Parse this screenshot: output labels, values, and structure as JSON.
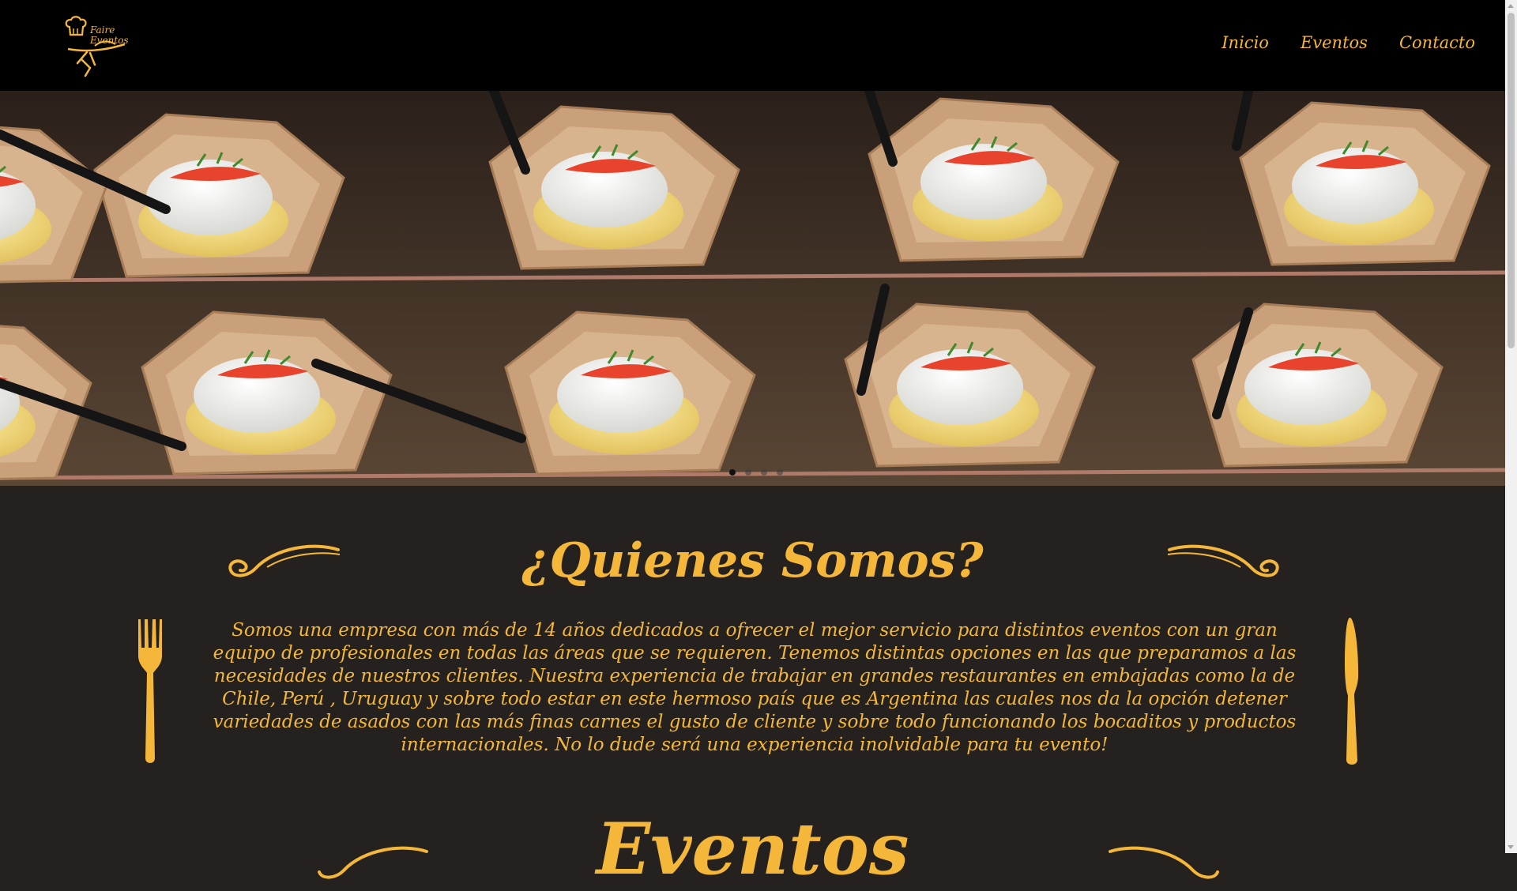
{
  "brand": {
    "logo_line1": "Faire",
    "logo_line2": "Eventos",
    "color": "#f4b73a"
  },
  "nav": {
    "items": [
      {
        "label": "Inicio"
      },
      {
        "label": "Eventos"
      },
      {
        "label": "Contacto"
      }
    ]
  },
  "hero": {
    "slide_count": 4,
    "active_slide": 1
  },
  "about": {
    "title": "¿Quienes Somos?",
    "body": "Somos una empresa con más de 14 años dedicados a ofrecer el mejor servicio para distintos eventos con un gran equipo de profesionales en todas las áreas que se requieren. Tenemos distintas opciones en las que preparamos a las necesidades de nuestros clientes. Nuestra experiencia de trabajar en grandes restaurantes en embajadas como la de Chile, Perú , Uruguay y sobre todo estar en este hermoso país que es Argentina las cuales nos da la opción detener variedades de asados con las más finas carnes el gusto de cliente y sobre todo funcionando los bocaditos y productos internacionales. No lo dude será una experiencia inolvidable para tu evento!"
  },
  "events": {
    "title": "Eventos"
  }
}
